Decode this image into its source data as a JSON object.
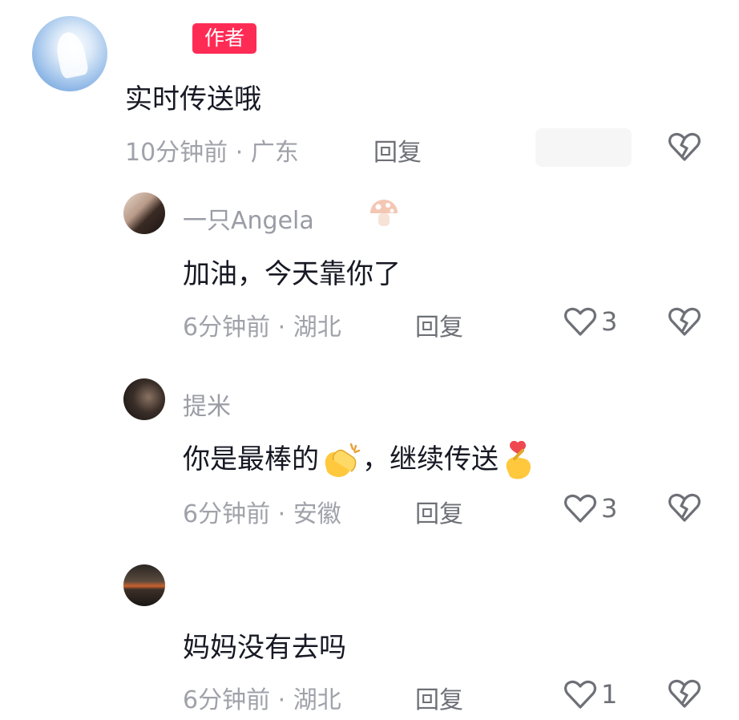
{
  "comments": [
    {
      "badge": "作者",
      "content": "实时传送哦",
      "time": "10分钟前",
      "location": "广东",
      "reply": "回复"
    }
  ],
  "replies": [
    {
      "username": "一只Angela",
      "content": "加油，今天靠你了",
      "time": "6分钟前",
      "location": "湖北",
      "reply": "回复",
      "likes": "3"
    },
    {
      "username": "提米",
      "content_part1": "你是最棒的",
      "content_part2": "，继续传送",
      "time": "6分钟前",
      "location": "安徽",
      "reply": "回复",
      "likes": "3"
    },
    {
      "content": "妈妈没有去吗",
      "time": "6分钟前",
      "location": "湖北",
      "reply": "回复",
      "likes": "1"
    }
  ],
  "separator": " · ",
  "icons": {
    "like": "heart-outline-icon",
    "dislike": "broken-heart-icon",
    "username_decoration": "mushroom-icon",
    "emoji_clap": "clapping-hands-emoji",
    "emoji_heart_hand": "finger-heart-emoji"
  },
  "colors": {
    "badge_bg": "#fe2c55",
    "text_primary": "#161823",
    "text_secondary": "#a0a2aa"
  }
}
